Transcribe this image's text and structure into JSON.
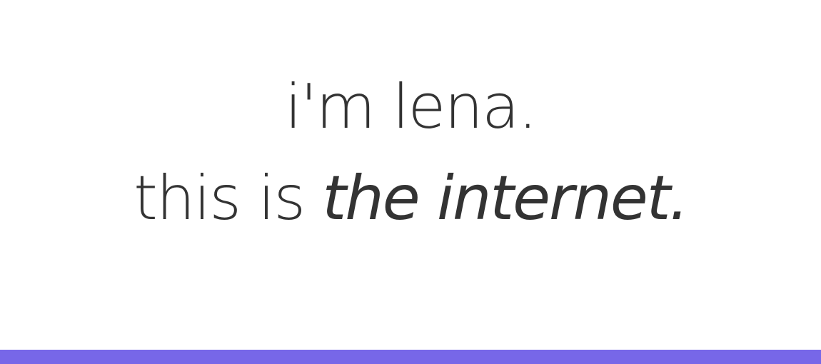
{
  "hero": {
    "greeting": "i'm lena.",
    "tagline_prefix": "this is ",
    "tagline_emphasis": "the internet."
  },
  "colors": {
    "text": "#333333",
    "background": "#ffffff",
    "accent_bar": "#7767e8"
  }
}
